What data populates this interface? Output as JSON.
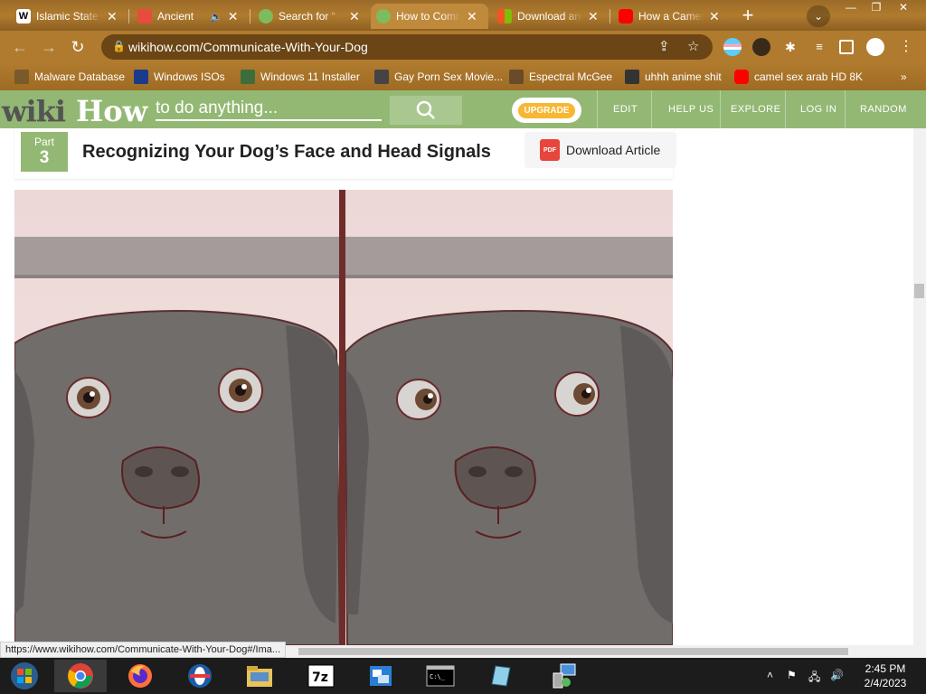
{
  "browser": {
    "tabs": [
      {
        "title": "Islamic State",
        "favicon": "wikipedia-icon",
        "color": "#ffffff"
      },
      {
        "title": "Ancient",
        "favicon": "youtube-icon",
        "color": "#e74c3c",
        "audio": true
      },
      {
        "title": "Search for “",
        "favicon": "rh-icon",
        "color": "#7dbb5c"
      },
      {
        "title": "How to Comm",
        "favicon": "rh-icon",
        "color": "#7dbb5c",
        "active": true
      },
      {
        "title": "Download and",
        "favicon": "microsoft-icon",
        "color": "#f35325"
      },
      {
        "title": "How a Camel",
        "favicon": "youtube-icon",
        "color": "#ff0000"
      }
    ],
    "new_tab": "+",
    "url": "wikihow.com/Communicate-With-Your-Dog",
    "bookmarks": [
      {
        "label": "Malware Database",
        "color": "#7a5a2a"
      },
      {
        "label": "Windows ISOs",
        "color": "#1a3a8a"
      },
      {
        "label": "Windows 11 Installer",
        "color": "#3c6e3c"
      },
      {
        "label": "Gay Porn Sex Movie...",
        "color": "#444444"
      },
      {
        "label": "Espectral McGee",
        "color": "#6b4a2a"
      },
      {
        "label": "uhhh anime shit",
        "color": "#333333"
      },
      {
        "label": "camel sex arab HD 8K",
        "color": "#ff0000"
      }
    ],
    "bookmarks_more": "»"
  },
  "wikihow": {
    "logo_wiki": "wiki",
    "logo_how": "How",
    "search_placeholder": "to do anything...",
    "upgrade": "UPGRADE",
    "nav": [
      "EDIT",
      "HELP US",
      "EXPLORE",
      "LOG IN",
      "RANDOM"
    ],
    "part_label": "Part",
    "part_number": "3",
    "part_title": "Recognizing Your Dog’s Face and Head Signals",
    "download_icon": "PDF",
    "download_label": "Download Article"
  },
  "status_url": "https://www.wikihow.com/Communicate-With-Your-Dog#/Ima...",
  "taskbar": {
    "apps": [
      "start-orb-icon",
      "chrome-icon",
      "firefox-icon",
      "opera-icon",
      "explorer-icon",
      "7zip-icon",
      "control-panel-icon",
      "cmd-icon",
      "notepad-icon",
      "network-icon"
    ],
    "time": "2:45 PM",
    "date": "2/4/2023"
  }
}
